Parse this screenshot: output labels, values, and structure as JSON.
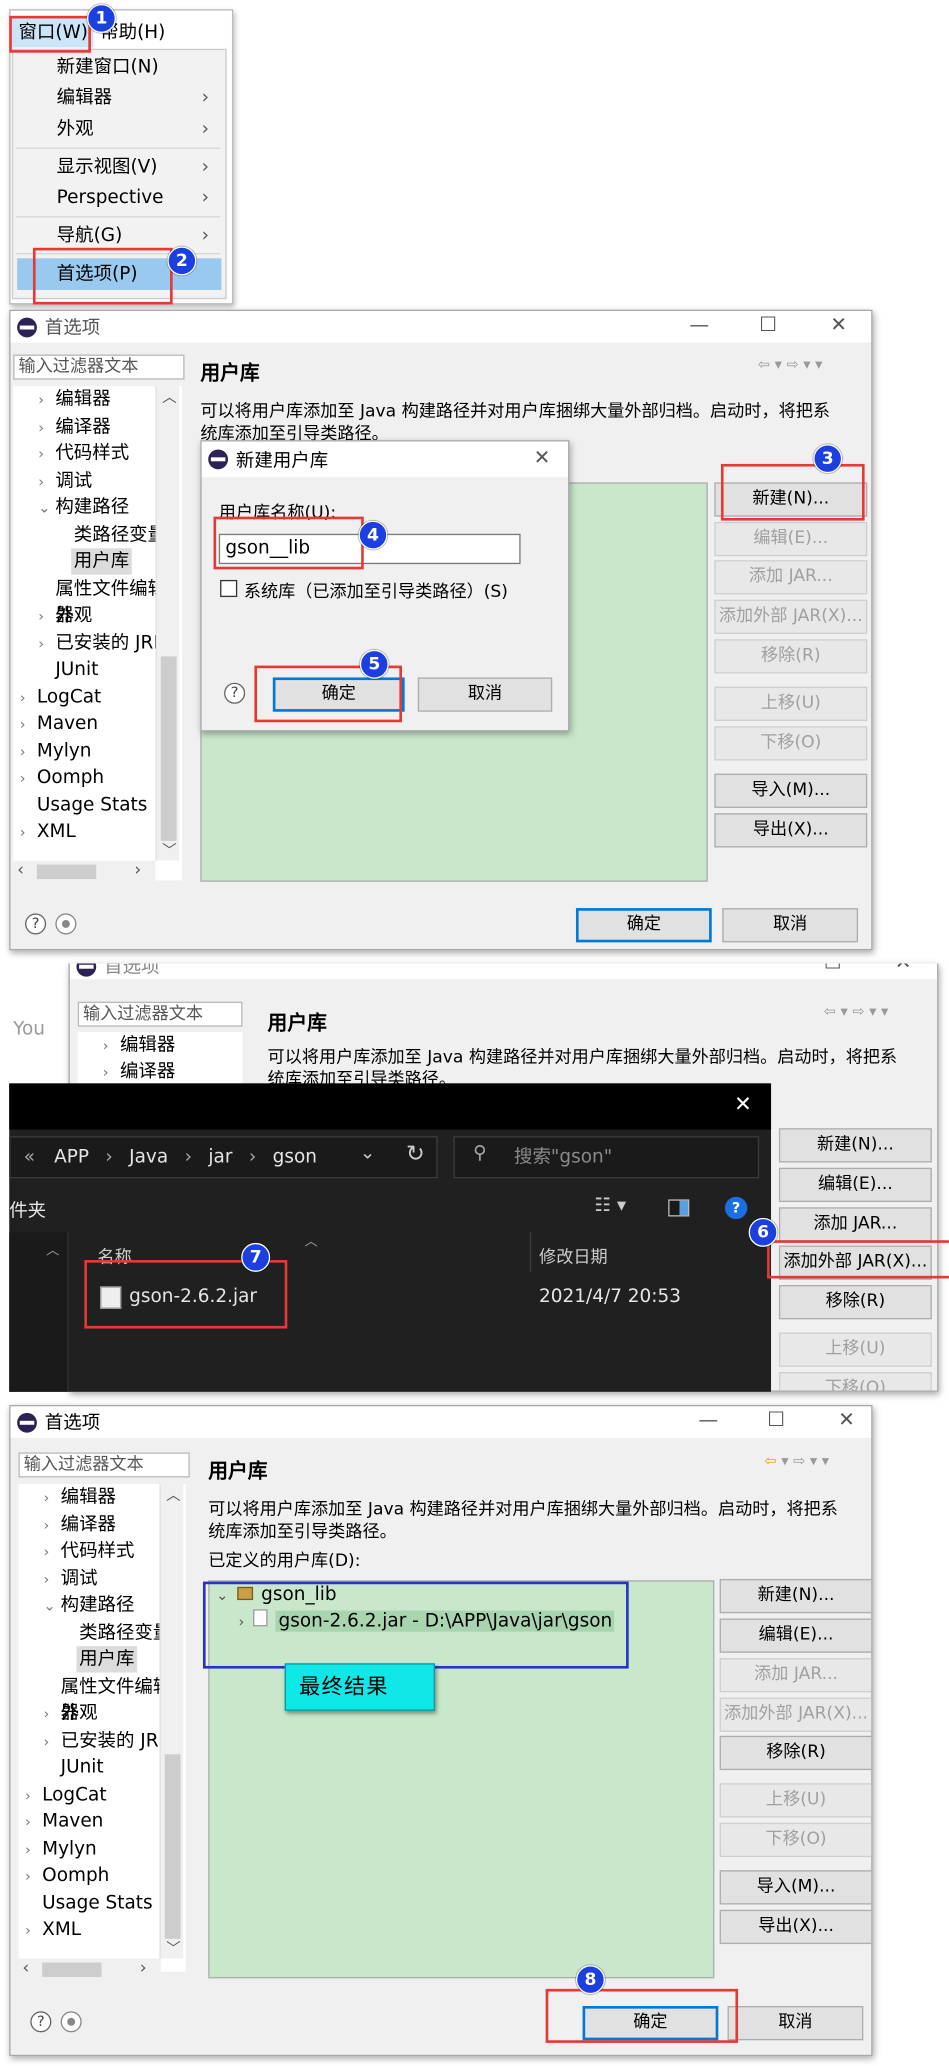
{
  "menu": {
    "window_menu": "窗口(W)",
    "help_menu": "帮助(H)",
    "items": [
      {
        "label": "新建窗口(N)"
      },
      {
        "label": "编辑器"
      },
      {
        "label": "外观"
      },
      {
        "label": "显示视图(V)"
      },
      {
        "label": "Perspective"
      },
      {
        "label": "导航(G)"
      },
      {
        "label": "首选项(P)"
      }
    ],
    "submenu_arrow": "›"
  },
  "steps": [
    "1",
    "2",
    "3",
    "4",
    "5",
    "6",
    "7",
    "8"
  ],
  "prefs": {
    "title": "首选项",
    "filter_placeholder": "输入过滤器文本",
    "tree": [
      {
        "label": "编辑器"
      },
      {
        "label": "编译器"
      },
      {
        "label": "代码样式"
      },
      {
        "label": "调试"
      },
      {
        "label": "构建路径"
      },
      {
        "label": "类路径变量"
      },
      {
        "label": "用户库"
      },
      {
        "label": "属性文件编辑器"
      },
      {
        "label": "外观"
      },
      {
        "label": "已安装的 JRE"
      },
      {
        "label": "JUnit"
      },
      {
        "label": "LogCat"
      },
      {
        "label": "Maven"
      },
      {
        "label": "Mylyn"
      },
      {
        "label": "Oomph"
      },
      {
        "label": "Usage Stats"
      },
      {
        "label": "XML"
      }
    ],
    "page_title": "用户库",
    "description_1": "可以将用户库添加至 Java 构建路径并对用户库捆绑大量外部归档。启动时，将把系",
    "description_2": "统库添加至引导类路径。",
    "defined_label": "已定义的用户库(D):",
    "buttons": {
      "new": "新建(N)...",
      "edit": "编辑(E)...",
      "add_jar": "添加 JAR...",
      "add_external_jar": "添加外部 JAR(X)...",
      "remove": "移除(R)",
      "up": "上移(U)",
      "down": "下移(O)",
      "import": "导入(M)...",
      "export": "导出(X)..."
    },
    "ok": "确定",
    "cancel": "取消",
    "help_glyph": "?"
  },
  "new_lib_dialog": {
    "title": "新建用户库",
    "name_label": "用户库名称(U):",
    "name_value": "gson__lib",
    "system_lib_label": "系统库（已添加至引导类路径）(S)",
    "ok": "确定",
    "cancel": "取消"
  },
  "file_dialog": {
    "breadcrumb": [
      "APP",
      "Java",
      "jar",
      "gson"
    ],
    "breadcrumb_prefix": "«",
    "search_placeholder": "搜索\"gson\"",
    "folder_label": "件夹",
    "col_name": "名称",
    "col_date": "修改日期",
    "file_name": "gson-2.6.2.jar",
    "file_date": "2021/4/7 20:53",
    "close_glyph": "✕"
  },
  "result": {
    "lib_name": "gson_lib",
    "jar_entry": "gson-2.6.2.jar - D:\\APP\\Java\\jar\\gson",
    "caption": "最终结果"
  },
  "other_text": {
    "you_fragment": "You"
  },
  "colors": {
    "step_badge": "#1c3fe0",
    "highlight_red": "#e53935",
    "highlight_blue": "#2733c7",
    "list_bg": "#c9e7cb",
    "menu_select": "#99c9ef",
    "caption_bg": "#10e8e8"
  }
}
